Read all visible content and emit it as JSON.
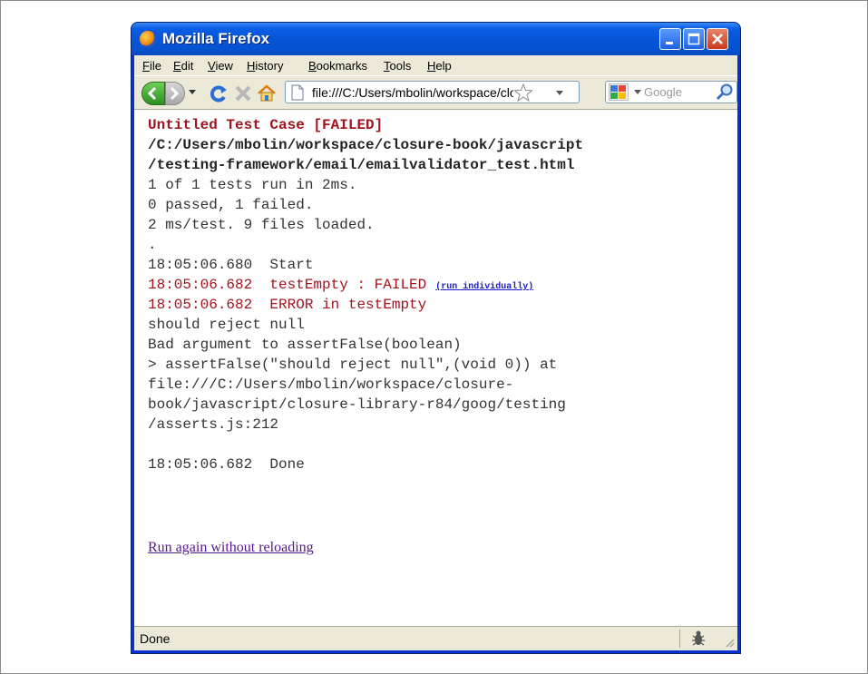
{
  "window": {
    "title": "Mozilla Firefox"
  },
  "menubar": {
    "items": [
      {
        "label": "File"
      },
      {
        "label": "Edit"
      },
      {
        "label": "View"
      },
      {
        "label": "History"
      },
      {
        "label": "Bookmarks"
      },
      {
        "label": "Tools"
      },
      {
        "label": "Help"
      }
    ]
  },
  "navbar": {
    "url": "file:///C:/Users/mbolin/workspace/closure-book/javascript/testing-framework/email/emailvalidator_test.html",
    "search_placeholder": "Google"
  },
  "content": {
    "lines": [
      {
        "text": "Untitled Test Case [FAILED]",
        "style": "header"
      },
      {
        "text": "/C:/Users/mbolin/workspace/closure-book/javascript",
        "style": "bold"
      },
      {
        "text": "/testing-framework/email/emailvalidator_test.html",
        "style": "bold"
      },
      {
        "text": "1 of 1 tests run in 2ms.",
        "style": "normal"
      },
      {
        "text": "0 passed, 1 failed.",
        "style": "normal"
      },
      {
        "text": "2 ms/test. 9 files loaded.",
        "style": "normal"
      },
      {
        "text": ".",
        "style": "normal"
      },
      {
        "text": "18:05:06.680  Start",
        "style": "normal"
      },
      {
        "text": "18:05:06.682  testEmpty : FAILED",
        "style": "error",
        "link": "(run individually)"
      },
      {
        "text": "18:05:06.682  ERROR in testEmpty",
        "style": "error"
      },
      {
        "text": "should reject null",
        "style": "normal"
      },
      {
        "text": "Bad argument to assertFalse(boolean)",
        "style": "normal"
      },
      {
        "text": "> assertFalse(\"should reject null\",(void 0)) at",
        "style": "normal"
      },
      {
        "text": "file:///C:/Users/mbolin/workspace/closure-",
        "style": "normal"
      },
      {
        "text": "book/javascript/closure-library-r84/goog/testing",
        "style": "normal"
      },
      {
        "text": "/asserts.js:212",
        "style": "normal"
      },
      {
        "text": "",
        "style": "normal"
      },
      {
        "text": "18:05:06.682  Done",
        "style": "normal"
      }
    ],
    "rerun_link": "Run again without reloading"
  },
  "statusbar": {
    "text": "Done"
  },
  "colors": {
    "error": "#a0141e",
    "link": "#1a1acc",
    "visited_link": "#551a8b",
    "titlebar": "#0754d8"
  },
  "icons": {
    "app": "firefox-icon",
    "back": "back-arrow-icon",
    "forward": "forward-arrow-icon",
    "reload": "reload-icon",
    "stop": "stop-icon",
    "home": "home-icon",
    "bookmark": "star-icon",
    "search": "magnifier-icon",
    "status": "firebug-icon"
  }
}
